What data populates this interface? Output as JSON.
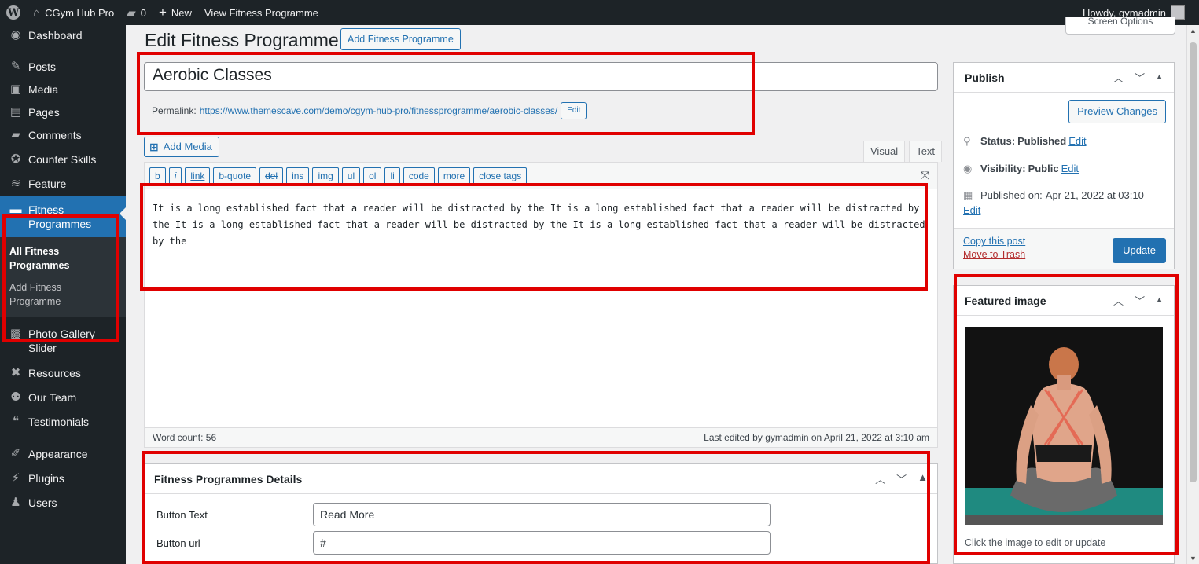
{
  "admin_bar": {
    "site_name": "CGym Hub Pro",
    "comments_count": "0",
    "new_label": "New",
    "view_label": "View Fitness Programme",
    "howdy": "Howdy, gymadmin"
  },
  "sidebar": {
    "items": [
      {
        "label": "Dashboard",
        "icon": "dashboard-icon"
      },
      {
        "label": "Posts",
        "icon": "pin-icon"
      },
      {
        "label": "Media",
        "icon": "media-icon"
      },
      {
        "label": "Pages",
        "icon": "pages-icon"
      },
      {
        "label": "Comments",
        "icon": "comments-icon"
      },
      {
        "label": "Counter Skills",
        "icon": "counter-icon"
      },
      {
        "label": "Feature",
        "icon": "feature-icon"
      },
      {
        "label": "Fitness Programmes",
        "icon": "fitness-icon"
      },
      {
        "label": "Photo Gallery Slider",
        "icon": "gallery-icon"
      },
      {
        "label": "Resources",
        "icon": "resources-icon"
      },
      {
        "label": "Our Team",
        "icon": "team-icon"
      },
      {
        "label": "Testimonials",
        "icon": "quote-icon"
      },
      {
        "label": "Appearance",
        "icon": "appearance-icon"
      },
      {
        "label": "Plugins",
        "icon": "plugins-icon"
      },
      {
        "label": "Users",
        "icon": "users-icon"
      }
    ],
    "submenu": {
      "all": "All Fitness Programmes",
      "add": "Add Fitness Programme"
    }
  },
  "header": {
    "title": "Edit Fitness Programme",
    "add_new": "Add Fitness Programme",
    "screen_options": "Screen Options"
  },
  "post": {
    "title": "Aerobic Classes",
    "permalink_label": "Permalink:",
    "permalink_url": "https://www.themescave.com/demo/cgym-hub-pro/fitnessprogramme/aerobic-classes/",
    "permalink_edit": "Edit"
  },
  "editor": {
    "add_media": "Add Media",
    "tab_visual": "Visual",
    "tab_text": "Text",
    "quicktags": [
      "b",
      "i",
      "link",
      "b-quote",
      "del",
      "ins",
      "img",
      "ul",
      "ol",
      "li",
      "code",
      "more",
      "close tags"
    ],
    "content": "It is a long established fact that a reader will be distracted by the It is a long established fact that a reader will be distracted by the It is a long established fact that a reader will be distracted by the It is a long established fact that a reader will be distracted by the",
    "word_count": "Word count: 56",
    "last_edited": "Last edited by gymadmin on April 21, 2022 at 3:10 am"
  },
  "details": {
    "title": "Fitness Programmes Details",
    "button_text_label": "Button Text",
    "button_text_value": "Read More",
    "button_url_label": "Button url",
    "button_url_value": "#"
  },
  "publish": {
    "title": "Publish",
    "preview": "Preview Changes",
    "status_label": "Status:",
    "status_value": "Published",
    "visibility_label": "Visibility:",
    "visibility_value": "Public",
    "published_label": "Published on:",
    "published_value": "Apr 21, 2022 at 03:10",
    "edit": "Edit",
    "copy_post": "Copy this post",
    "trash": "Move to Trash",
    "update": "Update"
  },
  "featured": {
    "title": "Featured image",
    "caption": "Click the image to edit or update"
  },
  "colors": {
    "accent": "#2271b1",
    "sidebar": "#1d2327",
    "highlight": "#e00000"
  }
}
